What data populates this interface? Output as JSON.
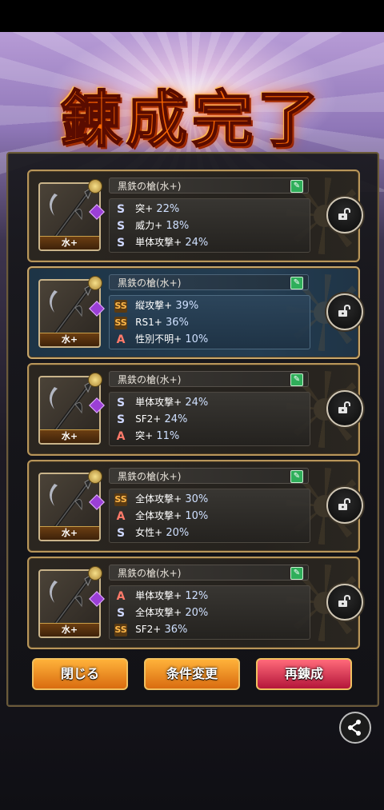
{
  "title": "錬成完了",
  "items": [
    {
      "name": "黒鉄の槍(水+)",
      "element": "水+",
      "selected": false,
      "stats": [
        {
          "rank": "S",
          "label": "突+",
          "value": "22%"
        },
        {
          "rank": "S",
          "label": "威力+",
          "value": "18%"
        },
        {
          "rank": "S",
          "label": "単体攻撃+",
          "value": "24%"
        }
      ]
    },
    {
      "name": "黒鉄の槍(水+)",
      "element": "水+",
      "selected": true,
      "stats": [
        {
          "rank": "SS",
          "label": "縦攻撃+",
          "value": "39%"
        },
        {
          "rank": "SS",
          "label": "RS1+",
          "value": "36%"
        },
        {
          "rank": "A",
          "label": "性別不明+",
          "value": "10%"
        }
      ]
    },
    {
      "name": "黒鉄の槍(水+)",
      "element": "水+",
      "selected": false,
      "stats": [
        {
          "rank": "S",
          "label": "単体攻撃+",
          "value": "24%"
        },
        {
          "rank": "S",
          "label": "SF2+",
          "value": "24%"
        },
        {
          "rank": "A",
          "label": "突+",
          "value": "11%"
        }
      ]
    },
    {
      "name": "黒鉄の槍(水+)",
      "element": "水+",
      "selected": false,
      "stats": [
        {
          "rank": "SS",
          "label": "全体攻撃+",
          "value": "30%"
        },
        {
          "rank": "A",
          "label": "全体攻撃+",
          "value": "10%"
        },
        {
          "rank": "S",
          "label": "女性+",
          "value": "20%"
        }
      ]
    },
    {
      "name": "黒鉄の槍(水+)",
      "element": "水+",
      "selected": false,
      "stats": [
        {
          "rank": "A",
          "label": "単体攻撃+",
          "value": "12%"
        },
        {
          "rank": "S",
          "label": "全体攻撃+",
          "value": "20%"
        },
        {
          "rank": "SS",
          "label": "SF2+",
          "value": "36%"
        }
      ]
    }
  ],
  "buttons": {
    "close": "閉じる",
    "change": "条件変更",
    "retry": "再錬成"
  },
  "icons": {
    "lock": "unlock-icon",
    "edit": "edit-icon",
    "share": "share-icon"
  }
}
